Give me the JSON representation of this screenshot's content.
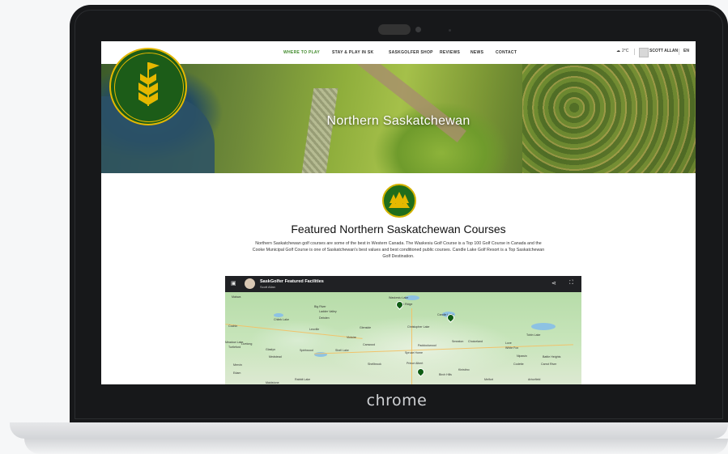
{
  "device": {
    "brand": "chrome"
  },
  "nav": {
    "links": [
      "WHERE TO PLAY",
      "STAY & PLAY IN SK",
      "SASKGOLFER SHOP",
      "REVIEWS",
      "NEWS",
      "CONTACT"
    ],
    "weather": "2°C",
    "user": "SCOTT ALLAN",
    "language": "EN"
  },
  "hero": {
    "title": "Northern Saskatchewan"
  },
  "featured": {
    "title": "Featured Northern Saskatchewan Courses",
    "description": "Northern Saskatchewan golf courses are some of the best in Western Canada. The Waskesiu Golf Course is a Top 100 Golf Course in Canada and the Cooke Municipal Golf Course is one of Saskatchewan's best values and best conditioned public courses. Candle Lake Golf Resort is a Top Saskatchewan Golf Destination."
  },
  "map": {
    "title": "SaskGolfer Featured Facilities",
    "subtitle": "Scott Allan",
    "labels": [
      "Waskesiu Lake",
      "Elk Ridge",
      "Candle Lake",
      "Big River",
      "Ladder Valley",
      "Debden",
      "Chitek Lake",
      "Leoville",
      "Spiritwood",
      "Shell Lake",
      "Canwood",
      "Shellbrook",
      "Prince Albert",
      "Christopher Lake",
      "Paddockwood",
      "Spruce Home",
      "Smeaton",
      "Choiceland",
      "Love",
      "White Fox",
      "Nipawin",
      "Codette",
      "Carrot River",
      "Tobin Lake",
      "Arborfield",
      "Melfort",
      "Birch Hills",
      "Kinistino",
      "Meadow Lake",
      "Medstead",
      "Glaslyn",
      "Turtleford",
      "Livelong",
      "Edam",
      "Mervin",
      "Maidstone",
      "Cochin",
      "Rabbit Lake",
      "Victoire",
      "Makwa",
      "Glenside",
      "Battle Heights"
    ]
  }
}
